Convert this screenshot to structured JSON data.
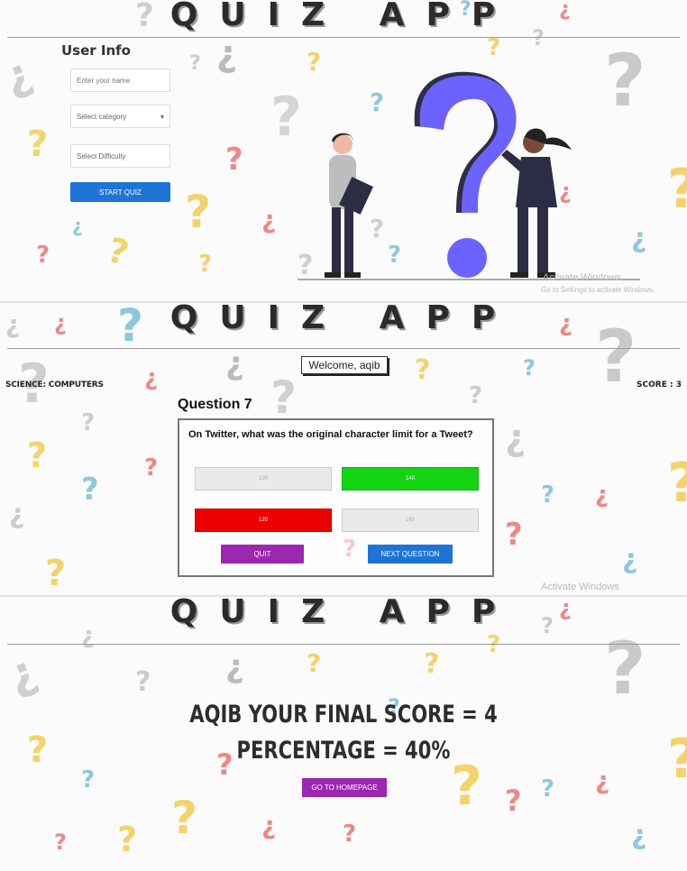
{
  "app_title": "QUIZ APP",
  "start_screen": {
    "heading": "User Info",
    "name_placeholder": "Enter your name",
    "category_placeholder": "Select category",
    "difficulty_placeholder": "Select Difficulty",
    "start_button": "START QUIZ",
    "watermark_line1": "Activate Windows",
    "watermark_line2": "Go to Settings to activate Windows."
  },
  "quiz_screen": {
    "welcome": "Welcome, aqib",
    "topic": "SCIENCE: COMPUTERS",
    "score": "SCORE : 3",
    "question_number": "Question 7",
    "question_text": "On Twitter, what was the original character limit for a Tweet?",
    "options": [
      {
        "label": "100",
        "state": "neutral"
      },
      {
        "label": "140",
        "state": "correct"
      },
      {
        "label": "120",
        "state": "wrong"
      },
      {
        "label": "160",
        "state": "neutral"
      }
    ],
    "quit_button": "QUIT",
    "next_button": "NEXT QUESTION",
    "watermark": "Activate Windows"
  },
  "result_screen": {
    "final_score": "AQIB YOUR FINAL SCORE = 4",
    "percentage": "PERCENTAGE = 40%",
    "home_button": "GO TO HOMEPAGE"
  },
  "colors": {
    "blue_button": "#1e74d6",
    "purple_button": "#9c27b0",
    "correct_option": "#14d414",
    "wrong_option": "#ee0000",
    "illustration_question_mark": "#6c63ff"
  }
}
